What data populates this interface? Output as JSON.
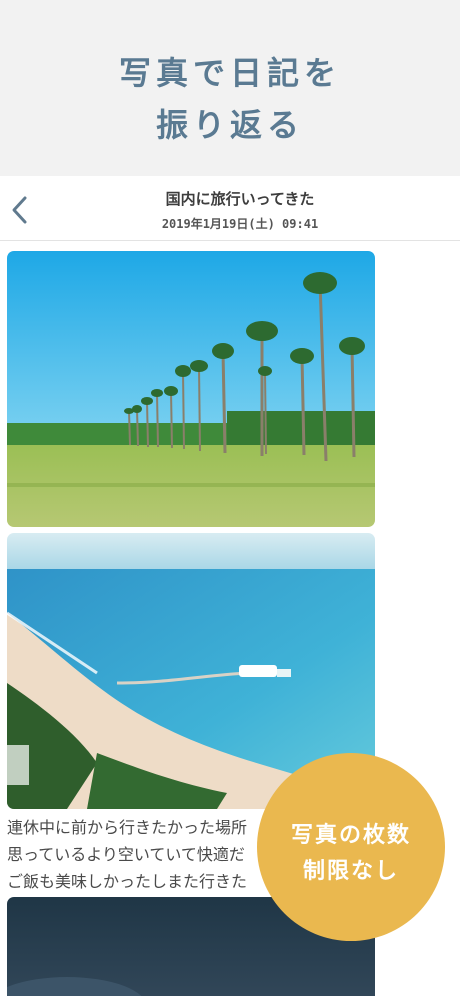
{
  "hero": {
    "line1": "写真で日記を",
    "line2": "振り返る"
  },
  "entry": {
    "title": "国内に旅行いってきた",
    "datetime": "2019年1月19日(土) 09:41",
    "body_lines": [
      "連休中に前から行きたかった場所",
      "思っているより空いていて快適だ",
      "ご飯も美味しかったしまた行きた"
    ]
  },
  "badge": {
    "line1": "写真の枚数",
    "line2": "制限なし"
  },
  "icons": {
    "back": "chevron-left-icon"
  },
  "colors": {
    "headline": "#5a7a92",
    "badge": "#eab84f",
    "hero_background": "#f2f2f2"
  }
}
